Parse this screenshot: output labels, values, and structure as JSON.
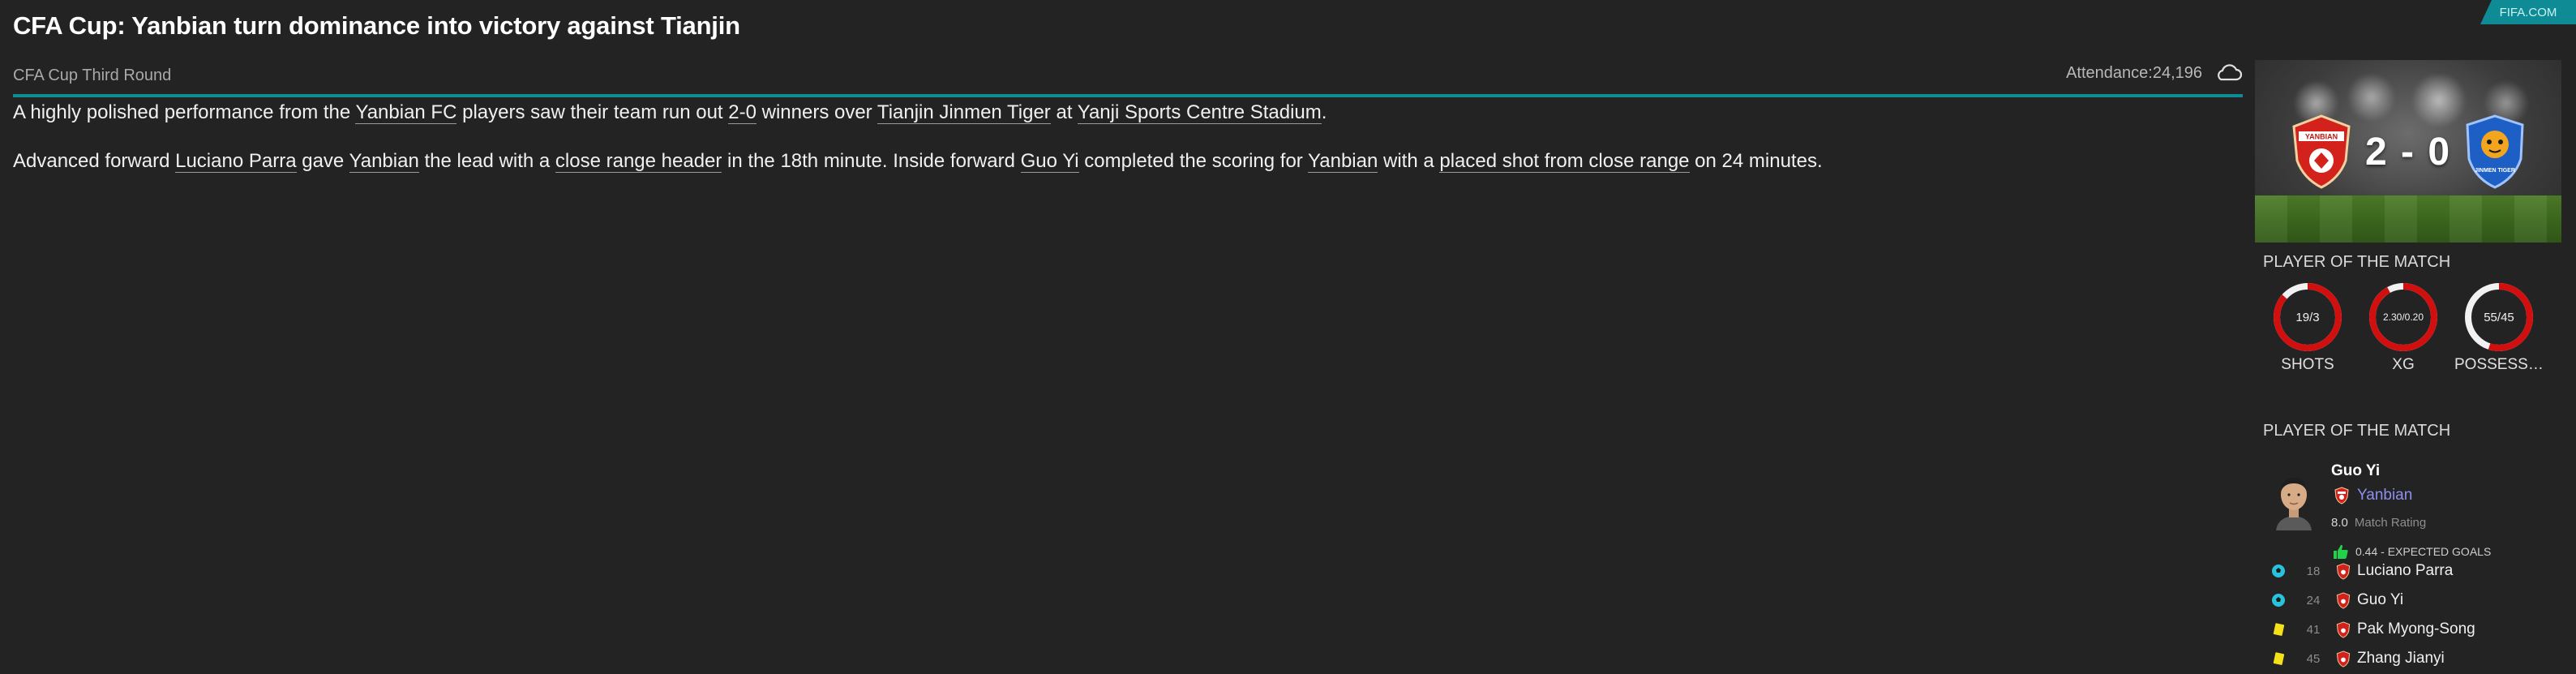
{
  "header": {
    "headline": "CFA Cup: Yanbian turn dominance into victory against Tianjin",
    "source_tag": "FIFA.COM"
  },
  "subheader": {
    "competition": "CFA Cup Third Round",
    "attendance_label": "Attendance:",
    "attendance_value": "24,196",
    "weather_icon": "cloud-icon"
  },
  "article": {
    "p1": {
      "t1": "A highly polished performance from the ",
      "l1": "Yanbian FC",
      "t2": " players saw their team run out ",
      "l2": "2-0",
      "t3": " winners over ",
      "l3": "Tianjin Jinmen Tiger",
      "t4": " at ",
      "l4": "Yanji Sports Centre Stadium",
      "t5": "."
    },
    "p2": {
      "t1": "Advanced forward ",
      "l1": "Luciano Parra",
      "t2": " gave ",
      "l2": "Yanbian",
      "t3": " the lead with a ",
      "l3": "close range header",
      "t4": " in the 18th minute. Inside forward ",
      "l4": "Guo Yi",
      "t5": " completed the scoring for ",
      "l5": "Yanbian",
      "t6": " with a ",
      "l6": "placed shot from close range",
      "t7": " on 24 minutes."
    }
  },
  "scoreboard": {
    "home_crest_text": "YANBIAN",
    "away_crest_text": "JINMEN TIGER",
    "score": "2 - 0"
  },
  "stats_section": {
    "title": "PLAYER OF THE MATCH",
    "stats": [
      {
        "label": "SHOTS",
        "value": "19/3",
        "home_share": 0.864
      },
      {
        "label": "XG",
        "value": "2.30/0.20",
        "home_share": 0.92
      },
      {
        "label": "POSSESSI...",
        "value": "55/45",
        "home_share": 0.55
      }
    ],
    "colors": {
      "home": "#d10f0f",
      "away": "#f2f2f2"
    }
  },
  "potm": {
    "title": "PLAYER OF THE MATCH",
    "name": "Guo Yi",
    "club": "Yanbian",
    "rating_value": "8.0",
    "rating_label": "Match Rating",
    "xg_text": "0.44 - EXPECTED GOALS"
  },
  "events": [
    {
      "icon": "ball-icon",
      "minute": "18",
      "player": "Luciano Parra"
    },
    {
      "icon": "ball-icon",
      "minute": "24",
      "player": "Guo Yi"
    },
    {
      "icon": "yellow-card-icon",
      "minute": "41",
      "player": "Pak Myong-Song"
    },
    {
      "icon": "yellow-card-icon",
      "minute": "45",
      "player": "Zhang Jianyi"
    }
  ]
}
